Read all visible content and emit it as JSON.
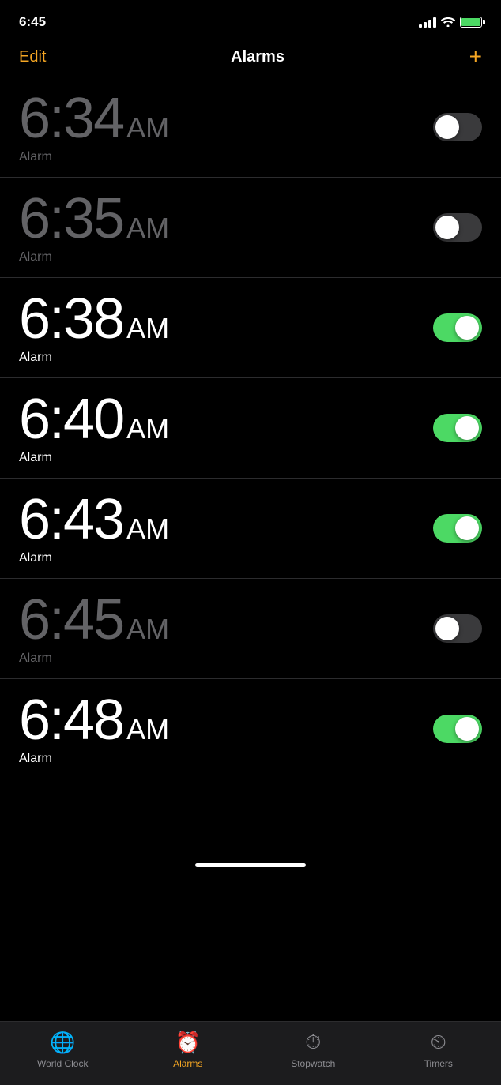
{
  "statusBar": {
    "time": "6:45",
    "batteryColor": "#4cd964"
  },
  "header": {
    "edit_label": "Edit",
    "title": "Alarms",
    "add_label": "+"
  },
  "alarms": [
    {
      "time": "6:34",
      "ampm": "AM",
      "label": "Alarm",
      "enabled": false
    },
    {
      "time": "6:35",
      "ampm": "AM",
      "label": "Alarm",
      "enabled": false
    },
    {
      "time": "6:38",
      "ampm": "AM",
      "label": "Alarm",
      "enabled": true
    },
    {
      "time": "6:40",
      "ampm": "AM",
      "label": "Alarm",
      "enabled": true
    },
    {
      "time": "6:43",
      "ampm": "AM",
      "label": "Alarm",
      "enabled": true
    },
    {
      "time": "6:45",
      "ampm": "AM",
      "label": "Alarm",
      "enabled": false
    },
    {
      "time": "6:48",
      "ampm": "AM",
      "label": "Alarm",
      "enabled": true
    }
  ],
  "tabBar": {
    "tabs": [
      {
        "id": "world-clock",
        "label": "World Clock",
        "icon": "🌐",
        "active": false
      },
      {
        "id": "alarms",
        "label": "Alarms",
        "icon": "⏰",
        "active": true
      },
      {
        "id": "stopwatch",
        "label": "Stopwatch",
        "icon": "⏱",
        "active": false
      },
      {
        "id": "timers",
        "label": "Timers",
        "icon": "⏲",
        "active": false
      }
    ]
  }
}
